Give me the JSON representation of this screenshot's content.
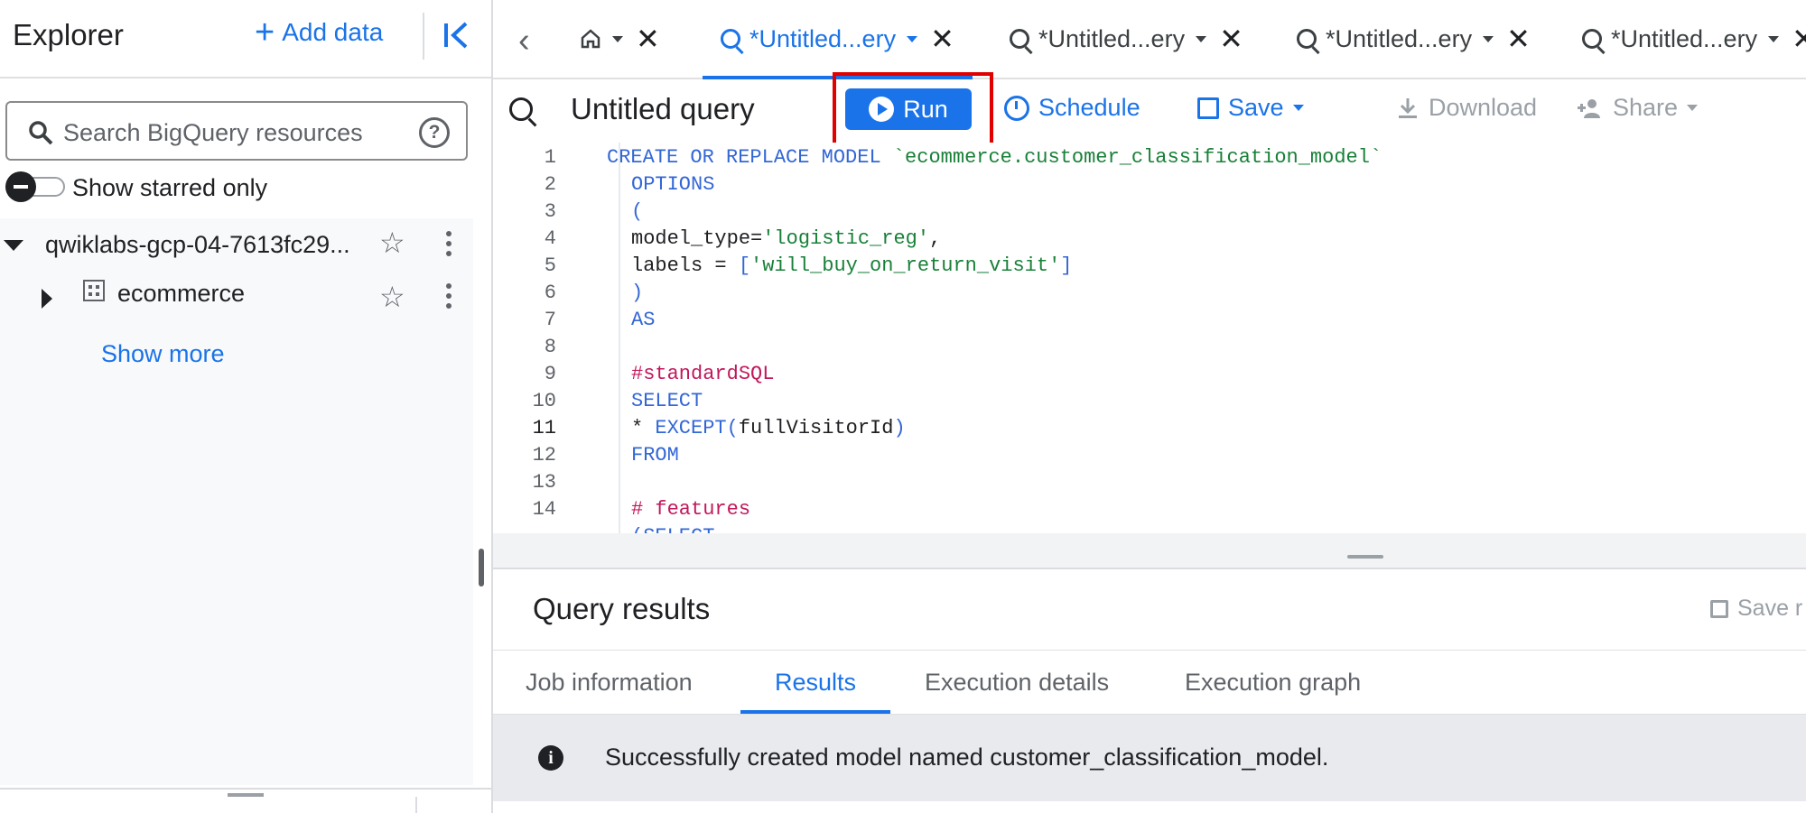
{
  "explorer": {
    "title": "Explorer",
    "add_data_label": "Add data",
    "search_placeholder": "Search BigQuery resources",
    "show_starred_label": "Show starred only",
    "project_name": "qwiklabs-gcp-04-7613fc29...",
    "dataset_name": "ecommerce",
    "show_more_label": "Show more"
  },
  "tabs": [
    {
      "label": "*Untitled...ery"
    },
    {
      "label": "*Untitled...ery"
    },
    {
      "label": "*Untitled...ery"
    },
    {
      "label": "*Untitled...ery"
    }
  ],
  "query": {
    "title": "Untitled query",
    "run_label": "Run",
    "schedule_label": "Schedule",
    "save_label": "Save",
    "download_label": "Download",
    "share_label": "Share"
  },
  "editor": {
    "current_line": "11",
    "line_numbers": [
      "1",
      "2",
      "3",
      "4",
      "5",
      "6",
      "7",
      "8",
      "9",
      "10",
      "11",
      "12",
      "13",
      "14"
    ],
    "code": {
      "l1_kw": "CREATE OR REPLACE MODEL",
      "l1_str": "`ecommerce.customer_classification_model`",
      "l2": "OPTIONS",
      "l3": "(",
      "l4_a": "model_type=",
      "l4_b": "'logistic_reg'",
      "l4_c": ",",
      "l5_a": "labels = ",
      "l5_b": "[",
      "l5_c": "'will_buy_on_return_visit'",
      "l5_d": "]",
      "l6": ")",
      "l7": "AS",
      "l9": "#standardSQL",
      "l10": "SELECT",
      "l11_a": "* ",
      "l11_b": "EXCEPT(",
      "l11_c": "fullVisitorId",
      "l11_d": ")",
      "l12": "FROM",
      "l14": "# features",
      "l15": "(SELECT"
    }
  },
  "results": {
    "title": "Query results",
    "save_results_label": "Save r",
    "tabs": [
      "Job information",
      "Results",
      "Execution details",
      "Execution graph"
    ],
    "active_tab": "Results",
    "message": "Successfully created model named customer_classification_model."
  },
  "colors": {
    "accent": "#1a73e8",
    "highlight_box": "#e00000",
    "keyword": "#3367d6",
    "string": "#188038",
    "comment": "#c2185b"
  }
}
